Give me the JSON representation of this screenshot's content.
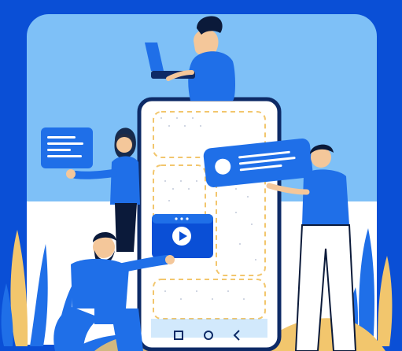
{
  "scene": {
    "title": "",
    "colors": {
      "background_blue": "#0a4fd6",
      "panel_light_blue": "#7ec0f7",
      "panel_white": "#ffffff",
      "accent_blue": "#1f6fe8",
      "phone_outline": "#0d2a66",
      "dashed_yellow": "#f2c66d",
      "plant_yellow": "#f2c66d",
      "skin": "#f4c79a",
      "dark": "#0b1a3a"
    },
    "icons": [
      "video-play-icon",
      "text-card-icon",
      "message-card-icon",
      "phone-home-icon",
      "phone-back-icon",
      "phone-square-icon"
    ]
  }
}
